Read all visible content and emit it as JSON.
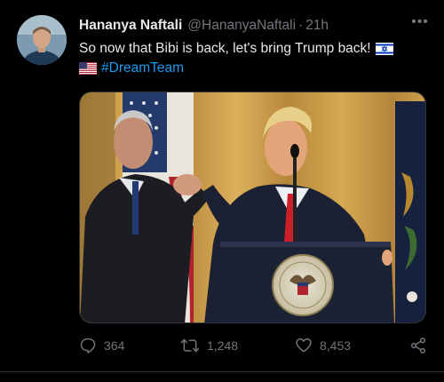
{
  "tweet": {
    "display_name": "Hananya Naftali",
    "handle": "@HananyaNaftali",
    "separator": "·",
    "time": "21h",
    "more_label": "•••",
    "text_line1": "So now that Bibi is back, let's bring Trump back!",
    "hashtag": "#DreamTeam",
    "flags": [
      "israel-flag",
      "usa-flag"
    ],
    "accent": "#1d9bf0"
  },
  "actions": {
    "reply_count": "364",
    "retweet_count": "1,248",
    "like_count": "8,453"
  },
  "icons": [
    "reply-icon",
    "retweet-icon",
    "heart-icon",
    "share-icon",
    "more-icon"
  ]
}
